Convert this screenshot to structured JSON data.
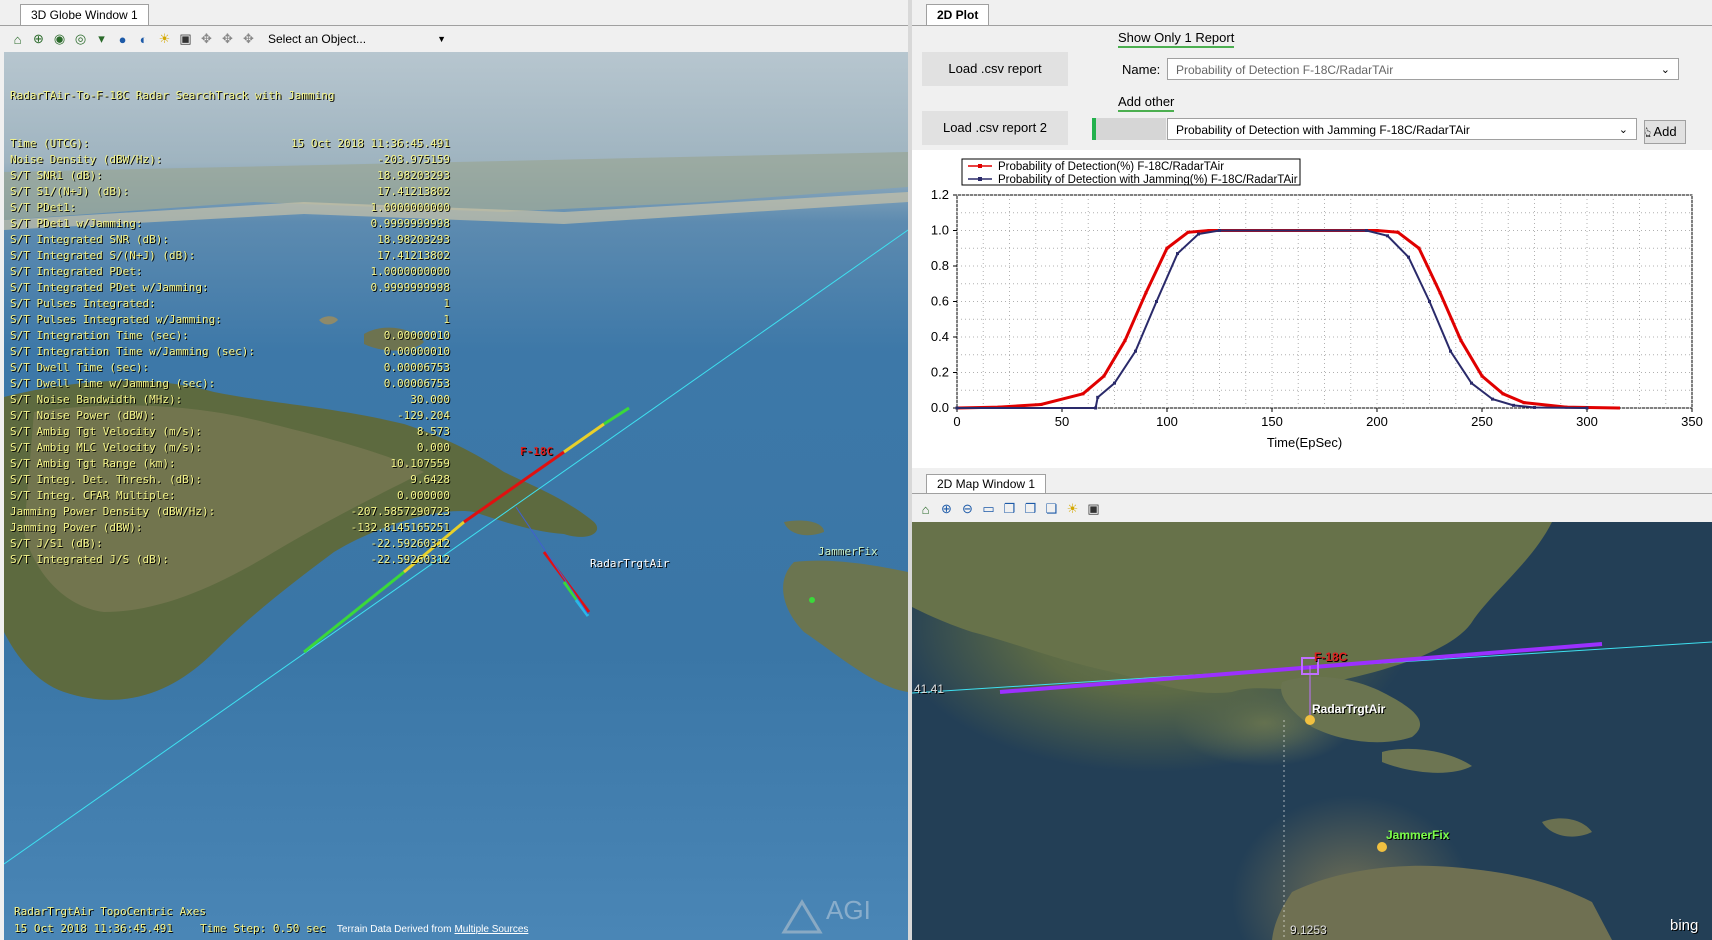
{
  "globe": {
    "tab": "3D Globe Window 1",
    "object_select": "Select an Object...",
    "report_title": "RadarTAir-To-F-18C Radar SearchTrack with Jamming",
    "report_rows": [
      [
        "Time (UTCG):",
        "15 Oct 2018 11:36:45.491"
      ],
      [
        "Noise Density (dBW/Hz):",
        "-203.975159"
      ],
      [
        "S/T SNR1 (dB):",
        "18.98203293"
      ],
      [
        "S/T S1/(N+J) (dB):",
        "17.41213802"
      ],
      [
        "S/T PDet1:",
        "1.0000000000"
      ],
      [
        "S/T PDet1 w/Jamming:",
        "0.9999999998"
      ],
      [
        "S/T Integrated SNR (dB):",
        "18.98203293"
      ],
      [
        "S/T Integrated S/(N+J) (dB):",
        "17.41213802"
      ],
      [
        "S/T Integrated PDet:",
        "1.0000000000"
      ],
      [
        "S/T Integrated PDet w/Jamming:",
        "0.9999999998"
      ],
      [
        "S/T Pulses Integrated:",
        "1"
      ],
      [
        "S/T Pulses Integrated w/Jamming:",
        "1"
      ],
      [
        "S/T Integration Time (sec):",
        "0.00000010"
      ],
      [
        "S/T Integration Time w/Jamming (sec):",
        "0.00000010"
      ],
      [
        "S/T Dwell Time (sec):",
        "0.00006753"
      ],
      [
        "S/T Dwell Time w/Jamming (sec):",
        "0.00006753"
      ],
      [
        "S/T Noise Bandwidth (MHz):",
        "30.000"
      ],
      [
        "S/T Noise Power (dBW):",
        "-129.204"
      ],
      [
        "S/T Ambig Tgt Velocity (m/s):",
        "8.573"
      ],
      [
        "S/T Ambig MLC Velocity (m/s):",
        "0.000"
      ],
      [
        "S/T Ambig Tgt Range (km):",
        "10.107559"
      ],
      [
        "S/T Integ. Det. Thresh. (dB):",
        "9.6428"
      ],
      [
        "S/T Integ. CFAR Multiple:",
        "0.000000"
      ],
      [
        "Jamming Power Density (dBW/Hz):",
        "-207.5857290723"
      ],
      [
        "Jamming Power (dBW):",
        "-132.8145165251"
      ],
      [
        "S/T J/S1 (dB):",
        "-22.59260312"
      ],
      [
        "S/T Integrated J/S (dB):",
        "-22.59260312"
      ]
    ],
    "label_f18": "F-18C",
    "label_radar": "RadarTrgtAir",
    "label_jammer": "JammerFix",
    "axes_label": "RadarTrgtAir TopoCentric Axes",
    "status_time": "15 Oct 2018 11:36:45.491",
    "status_step": "Time Step: 0.50 sec",
    "terrain_credit": "Terrain Data Derived from",
    "terrain_link": "Multiple Sources",
    "watermark": "AGI"
  },
  "plot": {
    "tab": "2D Plot",
    "load_btn": "Load .csv report",
    "load_btn2": "Load .csv report 2",
    "show_only_label": "Show Only 1 Report",
    "name_label": "Name:",
    "name_value": "Probability of Detection F-18C/RadarTAir",
    "add_other_label": "Add other",
    "other_value": "Probability of Detection with Jamming F-18C/RadarTAir",
    "add_btn": "Add",
    "progress_fraction": 0.06
  },
  "chart_data": {
    "type": "line",
    "xlabel": "Time(EpSec)",
    "ylabel": "",
    "xlim": [
      0,
      350
    ],
    "ylim": [
      0,
      1.2
    ],
    "xticks": [
      "0",
      "50",
      "100",
      "150",
      "200",
      "250",
      "300",
      "350"
    ],
    "yticks": [
      "0.0",
      "0.2",
      "0.4",
      "0.6",
      "0.8",
      "1.0",
      "1.2"
    ],
    "grid": true,
    "legend_position": "top-left",
    "series": [
      {
        "name": "Probability of Detection(%) F-18C/RadarTAir",
        "color": "#e00000",
        "x": [
          0,
          20,
          40,
          60,
          70,
          80,
          90,
          100,
          110,
          120,
          200,
          210,
          220,
          230,
          240,
          250,
          260,
          270,
          290,
          315
        ],
        "y": [
          0,
          0.005,
          0.02,
          0.08,
          0.18,
          0.38,
          0.65,
          0.9,
          0.99,
          1.0,
          1.0,
          0.99,
          0.9,
          0.65,
          0.38,
          0.18,
          0.08,
          0.03,
          0.005,
          0
        ]
      },
      {
        "name": "Probability of Detection with Jamming(%) F-18C/RadarTAir",
        "color": "#2a2a6a",
        "x": [
          0,
          66,
          67,
          75,
          85,
          95,
          105,
          115,
          125,
          195,
          205,
          215,
          225,
          235,
          245,
          255,
          265,
          275,
          300
        ],
        "y": [
          0,
          0,
          0.06,
          0.14,
          0.32,
          0.6,
          0.87,
          0.98,
          1.0,
          1.0,
          0.97,
          0.85,
          0.6,
          0.32,
          0.14,
          0.05,
          0.015,
          0.003,
          0
        ]
      }
    ]
  },
  "map2d": {
    "tab": "2D Map Window 1",
    "label_f18": "F-18C",
    "label_radar": "RadarTrgtAir",
    "label_jammer": "JammerFix",
    "lat_label": "41.41",
    "lon_label": "9.1253",
    "bing": "bing"
  },
  "colors": {
    "accent_green": "#4caf50",
    "track_purple": "#9b30ff",
    "overlay_yellow": "#f5f58a"
  }
}
